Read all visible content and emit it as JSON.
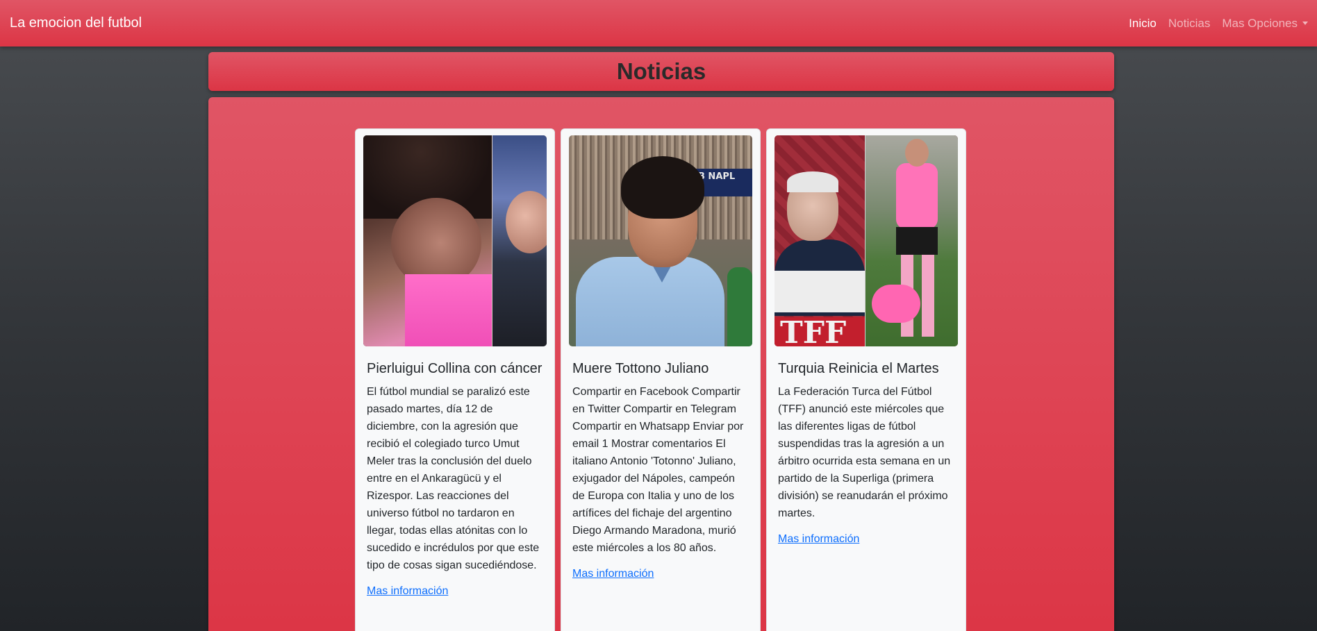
{
  "navbar": {
    "brand": "La emocion del futbol",
    "links": [
      {
        "label": "Inicio",
        "active": true
      },
      {
        "label": "Noticias",
        "active": false
      },
      {
        "label": "Mas Opciones",
        "active": false,
        "dropdown": true
      }
    ]
  },
  "page_title": "Noticias",
  "cards": [
    {
      "title": "Pierluigui Collina con cáncer",
      "text": "El fútbol mundial se paralizó este pasado martes, día 12 de diciembre, con la agresión que recibió el colegiado turco Umut Meler tras la conclusión del duelo entre en el Ankaragücü y el Rizespor. Las reacciones del universo fútbol no tardaron en llegar, todas ellas atónitas con lo sucedido e incrédulos por que este tipo de cosas sigan sucediéndose.",
      "link": "Mas información"
    },
    {
      "title": "Muere Tottono Juliano",
      "text": "Compartir en Facebook Compartir en Twitter Compartir en Telegram Compartir en Whatsapp Enviar por email 1 Mostrar comentarios El italiano Antonio 'Totonno' Juliano, exjugador del Nápoles, campeón de Europa con Italia y uno de los artífices del fichaje del argentino Diego Armando Maradona, murió este miércoles a los 80 años.",
      "link": "Mas información",
      "image_text": "B NAPL"
    },
    {
      "title": "Turquia Reinicia el Martes",
      "text": "La Federación Turca del Fútbol (TFF) anunció este miércoles que las diferentes ligas de fútbol suspendidas tras la agresión a un árbitro ocurrida esta semana en un partido de la Superliga (primera división) se reanudarán el próximo martes.",
      "link": "Mas información",
      "image_text": "TFF"
    }
  ],
  "colors": {
    "primary": "#dc3545",
    "link": "#0d6efd",
    "card_bg": "#f8f9fa"
  }
}
